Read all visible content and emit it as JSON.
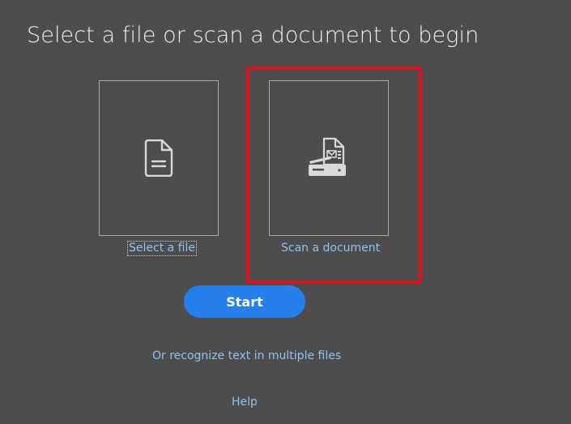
{
  "header": {
    "title": "Select a file or scan a document to begin"
  },
  "options": {
    "select_file": {
      "label": "Select a file",
      "icon": "document-icon"
    },
    "scan_document": {
      "label": "Scan a document",
      "icon": "scanner-icon",
      "highlighted": true
    }
  },
  "actions": {
    "start_label": "Start",
    "multiple_files_label": "Or recognize text in multiple files",
    "help_label": "Help"
  },
  "colors": {
    "background": "#4d4d4d",
    "accent": "#2680eb",
    "link": "#8ec3f2",
    "highlight": "#e1101a"
  }
}
